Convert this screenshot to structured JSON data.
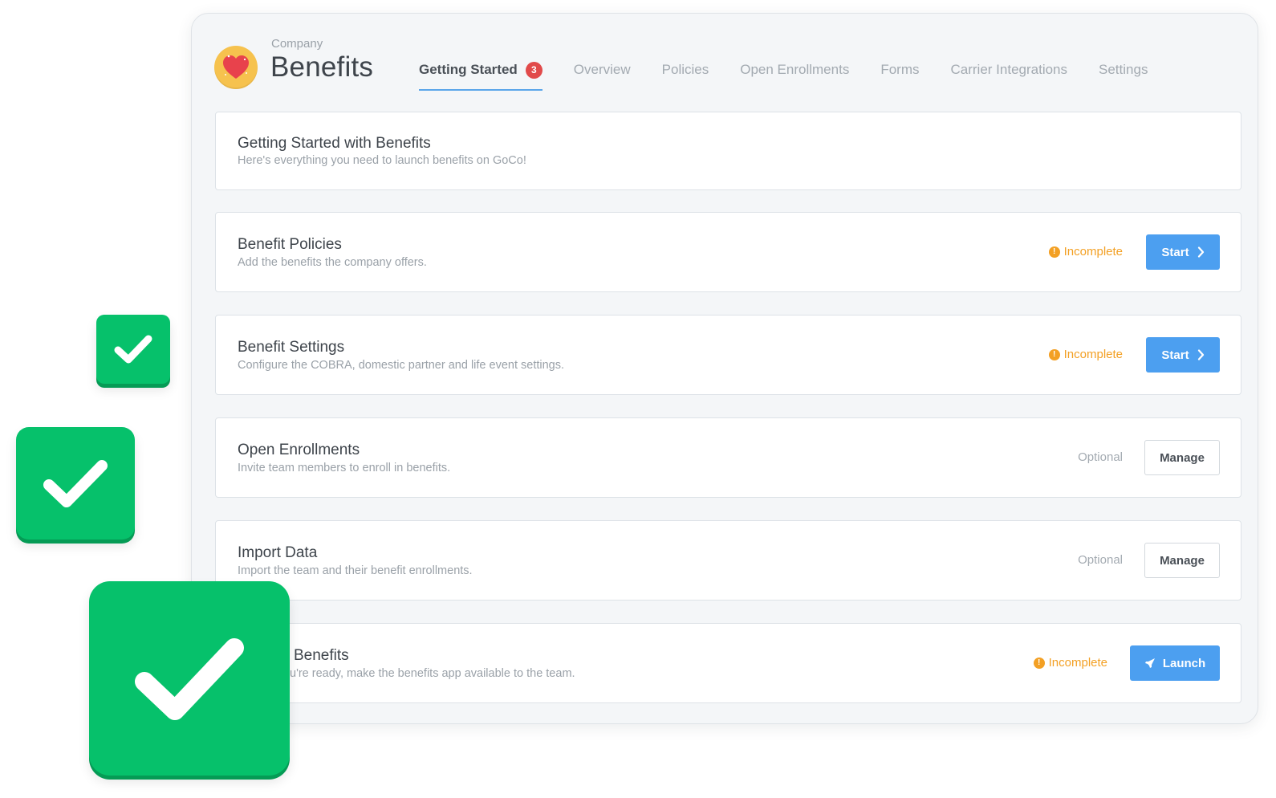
{
  "header": {
    "company_label": "Company",
    "title": "Benefits",
    "logo_icon": "heart-icon"
  },
  "tabs": [
    {
      "label": "Getting Started",
      "active": true,
      "badge": "3"
    },
    {
      "label": "Overview",
      "active": false
    },
    {
      "label": "Policies",
      "active": false
    },
    {
      "label": "Open Enrollments",
      "active": false
    },
    {
      "label": "Forms",
      "active": false
    },
    {
      "label": "Carrier Integrations",
      "active": false
    },
    {
      "label": "Settings",
      "active": false
    }
  ],
  "intro": {
    "title": "Getting Started with Benefits",
    "description": "Here's everything you need to launch benefits on GoCo!"
  },
  "steps": [
    {
      "title": "Benefit Policies",
      "description": "Add the benefits the company offers.",
      "status": "Incomplete",
      "button": "Start"
    },
    {
      "title": "Benefit Settings",
      "description": "Configure the COBRA, domestic partner and life event settings.",
      "status": "Incomplete",
      "button": "Start"
    },
    {
      "title": "Open Enrollments",
      "description": "Invite team members to enroll in benefits.",
      "status": "Optional",
      "button": "Manage"
    },
    {
      "title": "Import Data",
      "description": "Import the team and their benefit enrollments.",
      "status": "Optional",
      "button": "Manage"
    },
    {
      "title": "Benefits",
      "description": "u're ready, make the benefits app available to the team.",
      "status": "Incomplete",
      "button": "Launch"
    }
  ],
  "colors": {
    "accent": "#4c9ff0",
    "incomplete": "#f3a024",
    "badge": "#e14a4a",
    "check_green": "#06c16b"
  }
}
